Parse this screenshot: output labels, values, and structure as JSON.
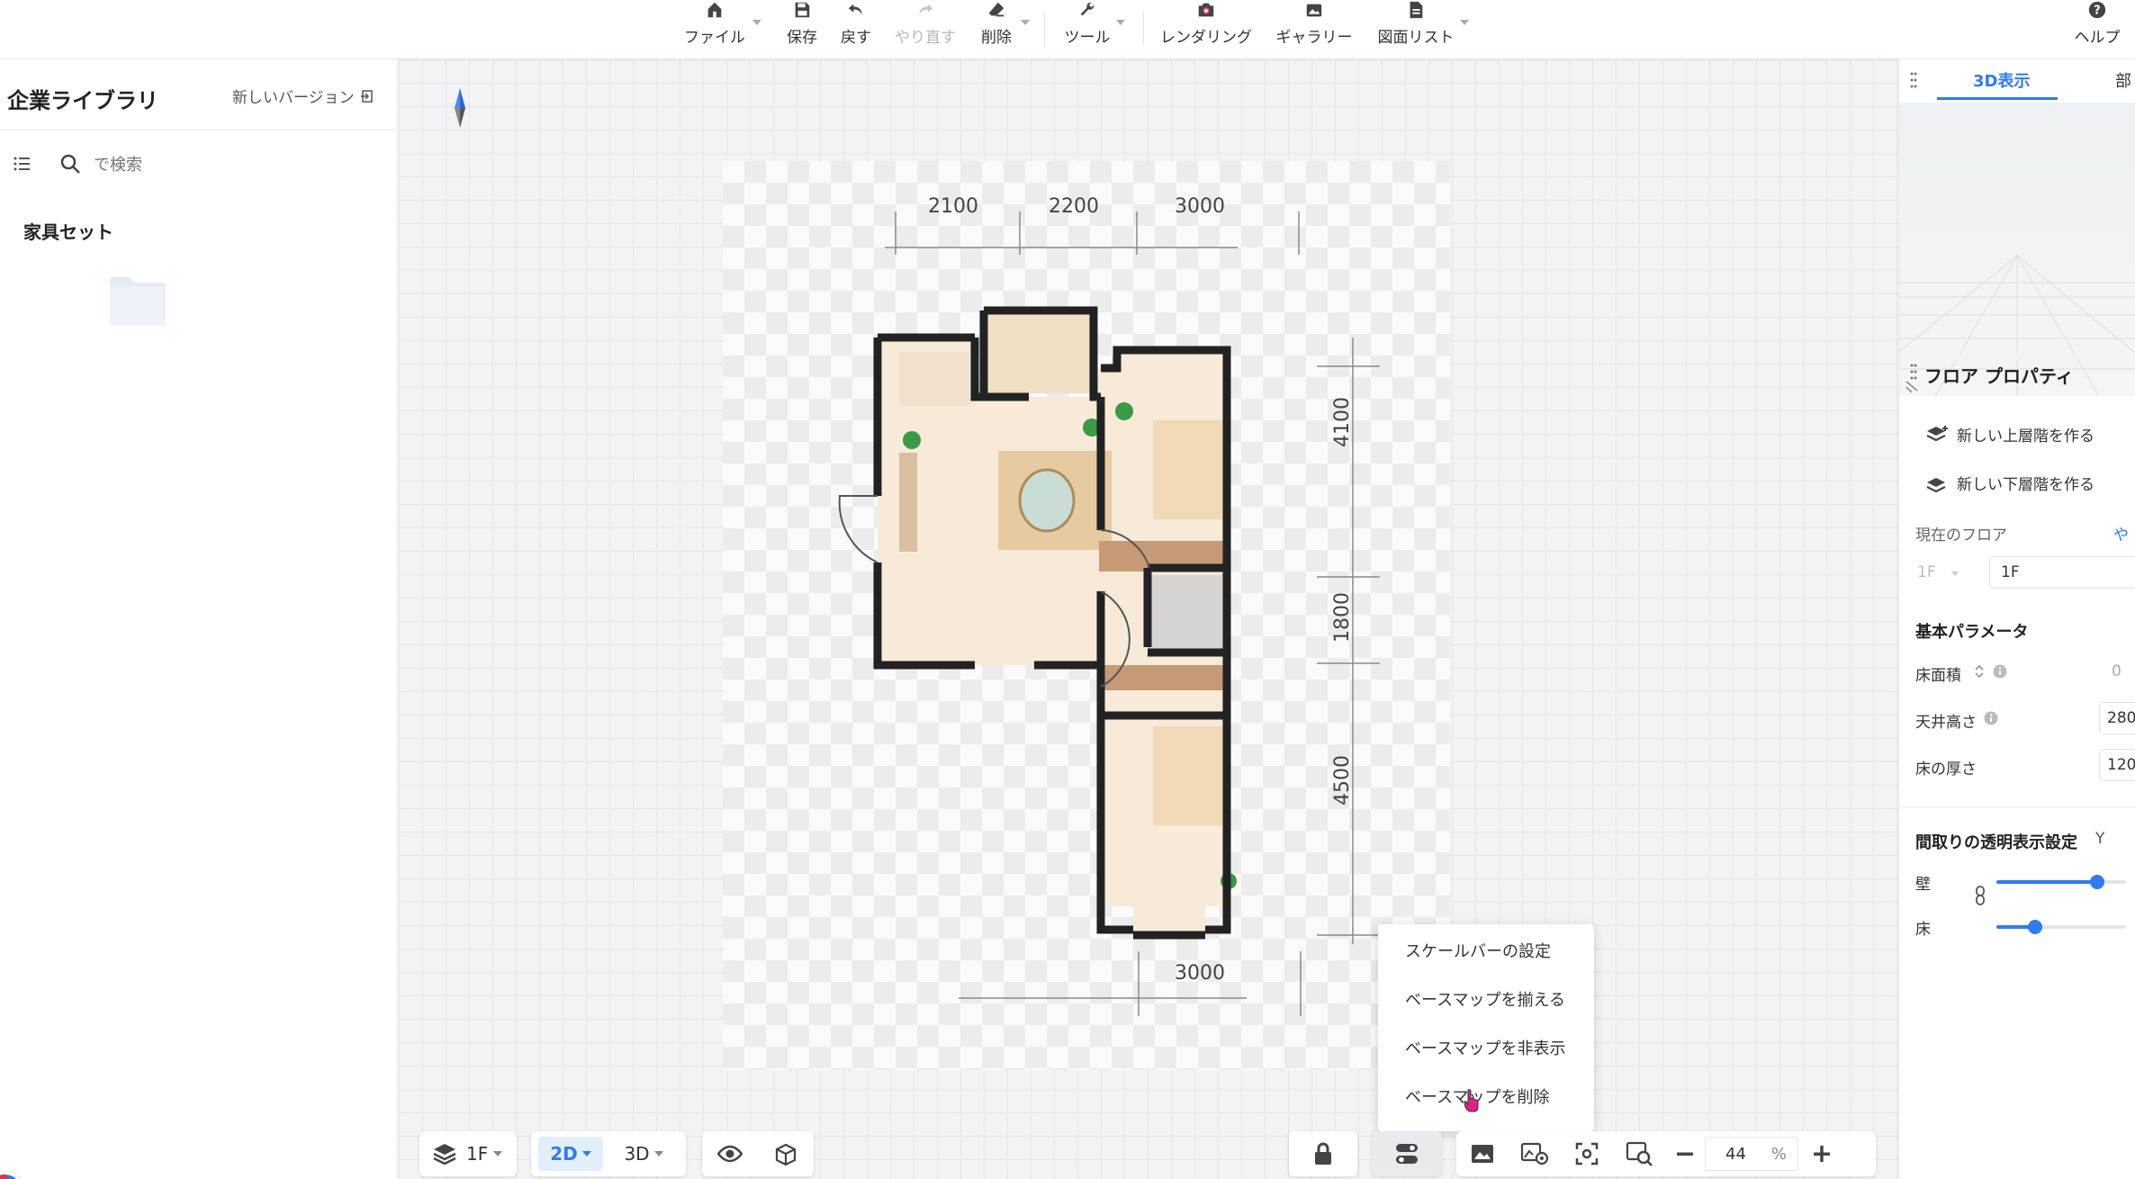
{
  "toolbar": {
    "file": "ファイル",
    "save": "保存",
    "undo": "戻す",
    "redo": "やり直す",
    "delete": "削除",
    "tools": "ツール",
    "rendering": "レンダリング",
    "gallery": "ギャラリー",
    "drawing_list": "図面リスト",
    "help": "ヘルプ"
  },
  "left_panel": {
    "title": "企業ライブラリ",
    "new_version": "新しいバージョン",
    "search_placeholder": "で検索",
    "section_title": "家具セット"
  },
  "floorplan": {
    "dim_top": [
      "2100",
      "2200",
      "3000"
    ],
    "dim_bottom": "3000",
    "dim_right": [
      "4100",
      "1800",
      "4500"
    ]
  },
  "context_menu": {
    "items": [
      "スケールバーの設定",
      "ベースマップを揃える",
      "ベースマップを非表示",
      "ベースマップを削除"
    ]
  },
  "bottom_bar": {
    "floor": "1F",
    "view_2d": "2D",
    "view_3d": "3D",
    "zoom": "44",
    "zoom_unit": "%"
  },
  "right_panel": {
    "tab_3d": "3D表示",
    "tab_other": "部",
    "floor_props_title": "フロア プロパティ",
    "new_upper": "新しい上層階を作る",
    "new_lower": "新しい下層階を作る",
    "current_floor_label": "現在のフロア",
    "current_floor_link": "や",
    "floor_select": "1F",
    "floor_name": "1F",
    "basic_params": "基本パラメータ",
    "floor_area_label": "床面積",
    "floor_area_value": "0",
    "ceiling_label": "天井高さ",
    "ceiling_value": "280",
    "thickness_label": "床の厚さ",
    "thickness_value": "120",
    "transparency_title": "間取りの透明表示設定",
    "transparency_suffix": "Y",
    "wall_label": "壁",
    "floor_label": "床",
    "wall_opacity": 0.78,
    "floor_opacity": 0.3
  },
  "colors": {
    "accent": "#2f7bf0",
    "wall": "#222222",
    "floor_fill": "#f7ead8",
    "menu_cursor": "#e0208a"
  }
}
